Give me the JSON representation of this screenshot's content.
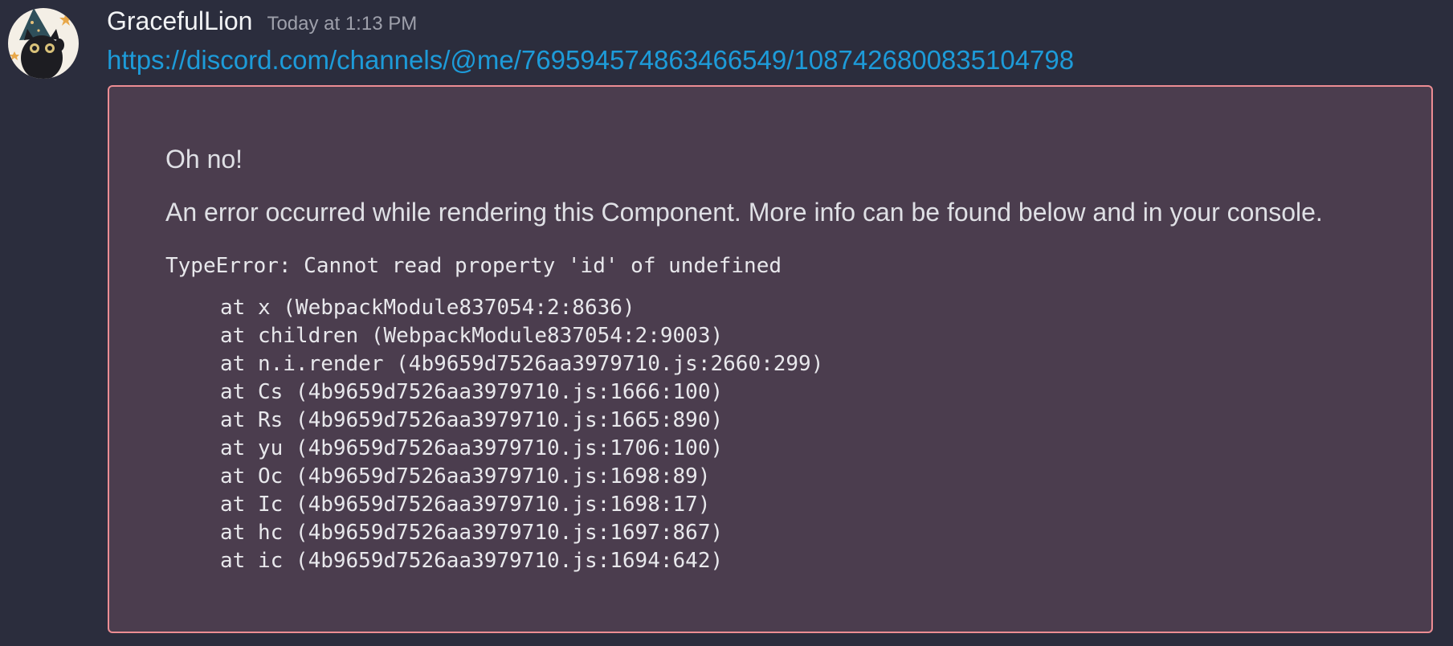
{
  "message": {
    "author": "GracefulLion",
    "timestamp": "Today at 1:13 PM",
    "link": "https://discord.com/channels/@me/769594574863466549/1087426800835104798"
  },
  "error": {
    "title": "Oh no!",
    "description": "An error occurred while rendering this Component. More info can be found below and in your console.",
    "type": "TypeError: Cannot read property 'id' of undefined",
    "stack": [
      "at x (WebpackModule837054:2:8636)",
      "at children (WebpackModule837054:2:9003)",
      "at n.i.render (4b9659d7526aa3979710.js:2660:299)",
      "at Cs (4b9659d7526aa3979710.js:1666:100)",
      "at Rs (4b9659d7526aa3979710.js:1665:890)",
      "at yu (4b9659d7526aa3979710.js:1706:100)",
      "at Oc (4b9659d7526aa3979710.js:1698:89)",
      "at Ic (4b9659d7526aa3979710.js:1698:17)",
      "at hc (4b9659d7526aa3979710.js:1697:867)",
      "at ic (4b9659d7526aa3979710.js:1694:642)"
    ]
  },
  "colors": {
    "background": "#2b2d3d",
    "link": "#1d9bd9",
    "error_box_bg": "#4b3d4e",
    "error_box_border": "#ec8d93"
  },
  "icons": {
    "avatar": "black-cat-wizard-avatar"
  }
}
